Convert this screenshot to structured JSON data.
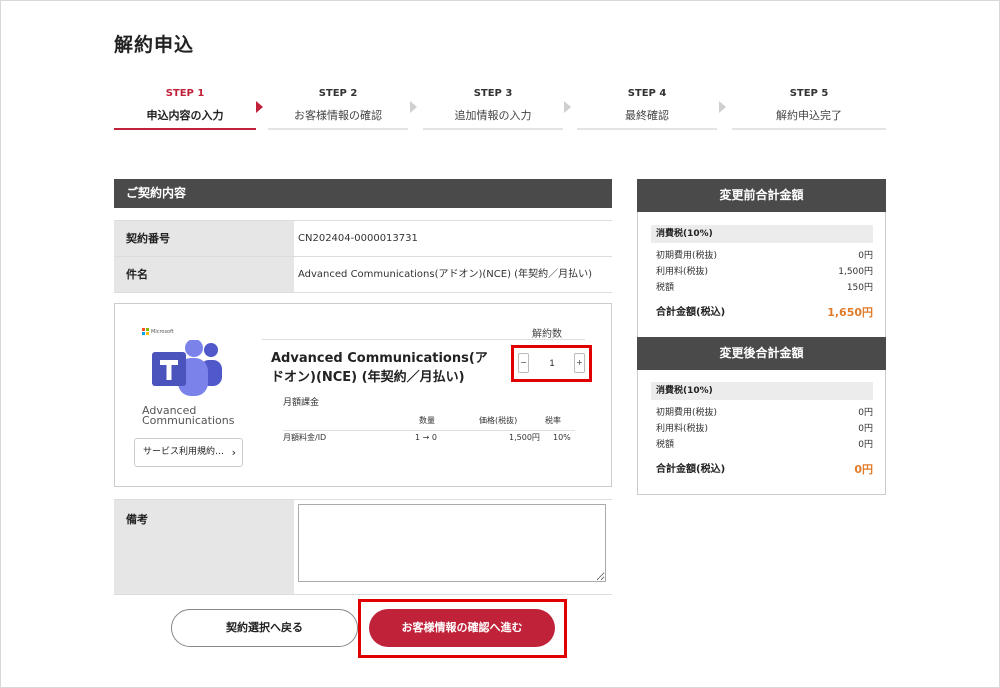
{
  "page": {
    "title": "解約申込"
  },
  "steps": [
    {
      "num": "STEP 1",
      "label": "申込内容の入力",
      "active": true
    },
    {
      "num": "STEP 2",
      "label": "お客様情報の確認",
      "active": false
    },
    {
      "num": "STEP 3",
      "label": "追加情報の入力",
      "active": false
    },
    {
      "num": "STEP 4",
      "label": "最終確認",
      "active": false
    },
    {
      "num": "STEP 5",
      "label": "解約申込完了",
      "active": false
    }
  ],
  "contract": {
    "header": "ご契約内容",
    "rows": [
      {
        "label": "契約番号",
        "value": "CN202404-0000013731"
      },
      {
        "label": "件名",
        "value": "Advanced Communications(アドオン)(NCE) (年契約／月払い)"
      }
    ]
  },
  "product": {
    "brand": "Microsoft",
    "icon": "teams-icon",
    "app_name_line1": "Advanced",
    "app_name_line2": "Communications",
    "terms_button": "サービス利用規約…",
    "title": "Advanced Communications(アドオン)(NCE) (年契約／月払い)",
    "qty_caption": "解約数",
    "qty_value": "1",
    "billing_label": "月額課金",
    "price_headers": {
      "qty": "数量",
      "price": "価格(税抜)",
      "tax": "税率"
    },
    "price_row": {
      "item": "月額料金/ID",
      "qty": "1 → 0",
      "price": "1,500円",
      "tax": "10%"
    }
  },
  "remarks": {
    "label": "備考",
    "value": ""
  },
  "buttons": {
    "back": "契約選択へ戻る",
    "next": "お客様情報の確認へ進む"
  },
  "summary_before": {
    "header": "変更前合計金額",
    "tax_label": "消費税(10%)",
    "rows": [
      {
        "label": "初期費用(税抜)",
        "value": "0円"
      },
      {
        "label": "利用料(税抜)",
        "value": "1,500円"
      },
      {
        "label": "税額",
        "value": "150円"
      }
    ],
    "total_label": "合計金額(税込)",
    "total_value": "1,650円"
  },
  "summary_after": {
    "header": "変更後合計金額",
    "tax_label": "消費税(10%)",
    "rows": [
      {
        "label": "初期費用(税抜)",
        "value": "0円"
      },
      {
        "label": "利用料(税抜)",
        "value": "0円"
      },
      {
        "label": "税額",
        "value": "0円"
      }
    ],
    "total_label": "合計金額(税込)",
    "total_value": "0円"
  },
  "colors": {
    "accent": "#c0223a",
    "highlight_border": "#e00000",
    "total": "#e07b2a",
    "header_bg": "#4a4a4a",
    "teams": "#5059c9"
  }
}
